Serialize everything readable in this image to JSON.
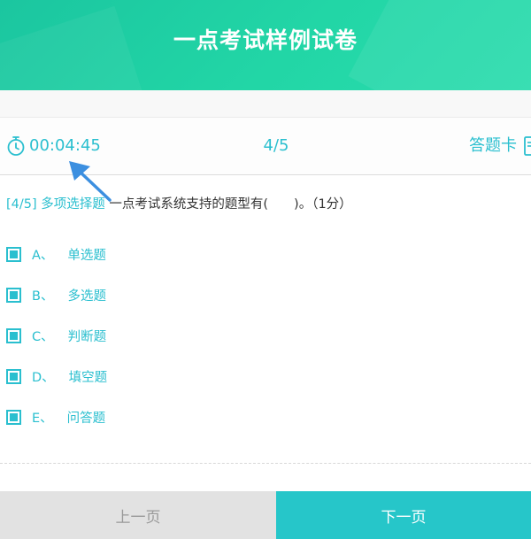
{
  "header": {
    "title": "一点考试样例试卷"
  },
  "info_bar": {
    "timer": "00:04:45",
    "progress": "4/5",
    "answer_card_label": "答题卡"
  },
  "question": {
    "index": "[4/5]",
    "type": "多项选择题",
    "text": "一点考试系统支持的题型有(　　)。（1分）"
  },
  "options": [
    {
      "letter": "A、",
      "text": "单选题",
      "checked": true
    },
    {
      "letter": "B、",
      "text": "多选题",
      "checked": true
    },
    {
      "letter": "C、",
      "text": "判断题",
      "checked": true
    },
    {
      "letter": "D、",
      "text": "填空题",
      "checked": true
    },
    {
      "letter": "E、",
      "text": "问答题",
      "checked": true
    }
  ],
  "footer": {
    "prev_label": "上一页",
    "next_label": "下一页"
  },
  "colors": {
    "accent": "#2abfcf",
    "header": "#22d6a6",
    "next_button": "#26c6c9",
    "prev_button": "#e2e2e2",
    "arrow": "#3c8fe0"
  }
}
